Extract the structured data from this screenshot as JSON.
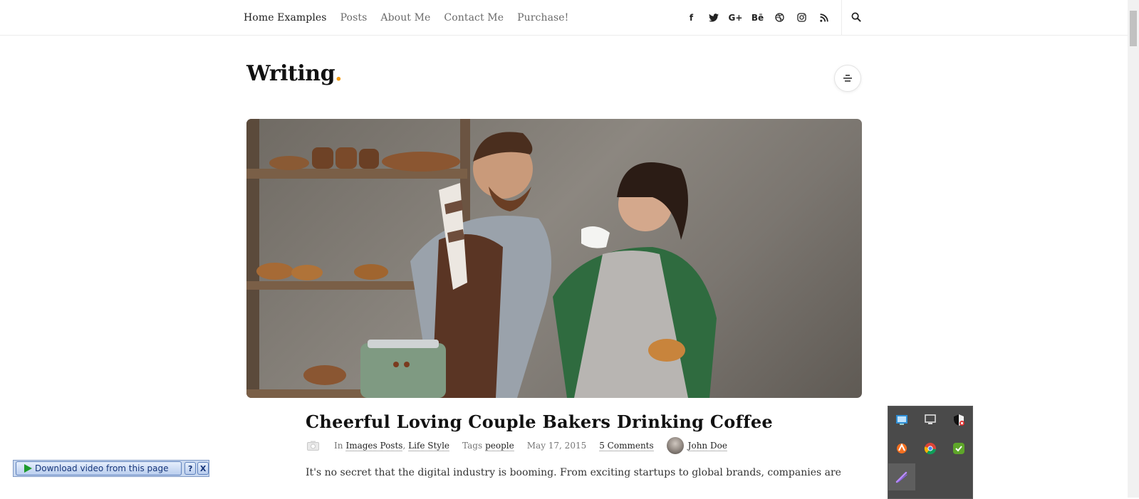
{
  "nav": {
    "items": [
      {
        "label": "Home Examples",
        "active": true
      },
      {
        "label": "Posts",
        "active": false
      },
      {
        "label": "About Me",
        "active": false
      },
      {
        "label": "Contact Me",
        "active": false
      },
      {
        "label": "Purchase!",
        "active": false
      }
    ],
    "social": [
      "facebook-icon",
      "twitter-icon",
      "google-plus-icon",
      "behance-icon",
      "dribbble-icon",
      "instagram-icon",
      "rss-icon"
    ],
    "social_glyphs": [
      "f",
      "t",
      "G+",
      "Bē",
      "◎",
      "◻",
      "◝"
    ]
  },
  "logo": {
    "text": "Writing",
    "dot": "."
  },
  "post": {
    "title": "Cheerful Loving Couple Bakers Drinking Coffee",
    "in_label": "In",
    "categories": [
      "Images Posts",
      "Life Style"
    ],
    "tags_label": "Tags",
    "tags": [
      "people"
    ],
    "date": "May 17, 2015",
    "comments": "5 Comments",
    "author": "John Doe",
    "excerpt": "It's no secret that the digital industry is booming. From exciting startups to global brands, companies are"
  },
  "download_bar": {
    "label": "Download video from this page",
    "help": "?",
    "close": "X"
  },
  "colors": {
    "accent": "#f39c12",
    "nav_text": "#6a6a6a"
  }
}
